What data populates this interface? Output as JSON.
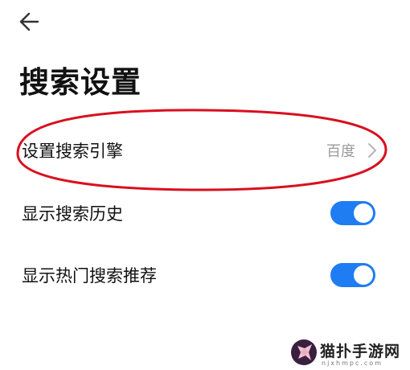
{
  "header": {
    "back_icon": "arrow-left-icon"
  },
  "page": {
    "title": "搜索设置"
  },
  "settings": [
    {
      "label": "设置搜索引擎",
      "value": "百度",
      "icon": "chevron-right-icon"
    },
    {
      "label": "显示搜索历史",
      "toggle_on": true
    },
    {
      "label": "显示热门搜索推荐",
      "toggle_on": true
    }
  ],
  "colors": {
    "toggle_on": "#1f7cf2",
    "annotation": "#d90f1e",
    "secondary_text": "#9b9b9b"
  },
  "watermark": {
    "text": "猫扑手游网",
    "subtext": "njxhmpc.com"
  }
}
